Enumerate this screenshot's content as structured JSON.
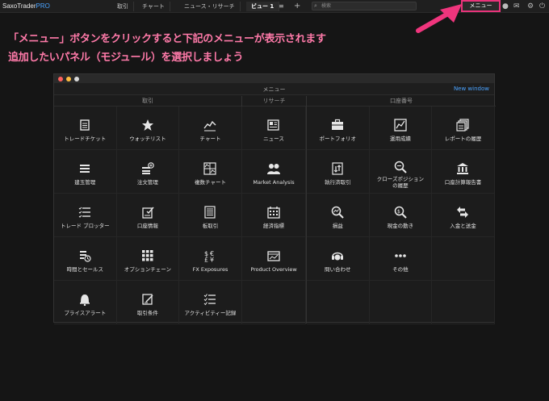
{
  "topbar": {
    "logo_main": "SaxoTrader",
    "logo_pro": "PRO",
    "tabs": [
      "取引",
      "チャート",
      "ニュース・リサーチ",
      "ビュー 1"
    ],
    "search_placeholder": "検索",
    "menu_button": "メニュー"
  },
  "annotation": {
    "line1": "「メニュー」ボタンをクリックすると下記のメニューが表示されます",
    "line2": "追加したいパネル（モジュール）を選択しましょう"
  },
  "window": {
    "title": "メニュー",
    "new_window": "New window"
  },
  "sections": [
    {
      "title": "取引",
      "items": [
        {
          "label": "トレードチケット",
          "icon": "trade-ticket-icon"
        },
        {
          "label": "ウォッチリスト",
          "icon": "star-icon"
        },
        {
          "label": "チャート",
          "icon": "chart-icon"
        },
        {
          "label": "建玉管理",
          "icon": "positions-icon"
        },
        {
          "label": "注文管理",
          "icon": "orders-icon"
        },
        {
          "label": "複数チャート",
          "icon": "multi-chart-icon"
        },
        {
          "label": "トレード ブロッター",
          "icon": "blotter-icon"
        },
        {
          "label": "口座情報",
          "icon": "account-info-icon"
        },
        {
          "label": "板取引",
          "icon": "depth-icon"
        },
        {
          "label": "時間とセールス",
          "icon": "time-sales-icon"
        },
        {
          "label": "オプションチェーン",
          "icon": "option-chain-icon"
        },
        {
          "label": "FX Exposures",
          "icon": "fx-exposure-icon"
        },
        {
          "label": "プライスアラート",
          "icon": "bell-icon"
        },
        {
          "label": "取引条件",
          "icon": "conditions-icon"
        },
        {
          "label": "アクティビティー記録",
          "icon": "activity-icon"
        }
      ]
    },
    {
      "title": "リサーチ",
      "items": [
        {
          "label": "ニュース",
          "icon": "news-icon"
        },
        {
          "label": "Market Analysis",
          "icon": "people-icon"
        },
        {
          "label": "経済指標",
          "icon": "calendar-icon"
        },
        {
          "label": "Product Overview",
          "icon": "product-icon"
        }
      ]
    },
    {
      "title": "口座番号",
      "items": [
        {
          "label": "ポートフォリオ",
          "icon": "portfolio-icon"
        },
        {
          "label": "運用成績",
          "icon": "performance-icon"
        },
        {
          "label": "レポートの履歴",
          "icon": "reports-icon"
        },
        {
          "label": "執行済取引",
          "icon": "executed-icon"
        },
        {
          "label": "クローズポジションの履歴",
          "icon": "closed-positions-icon"
        },
        {
          "label": "口座計算報告書",
          "icon": "bank-icon"
        },
        {
          "label": "損益",
          "icon": "pnl-icon"
        },
        {
          "label": "現金の動き",
          "icon": "cash-icon"
        },
        {
          "label": "入金と送金",
          "icon": "transfer-icon"
        },
        {
          "label": "問い合わせ",
          "icon": "support-icon"
        },
        {
          "label": "その他",
          "icon": "more-icon"
        }
      ]
    }
  ],
  "colors": {
    "accent": "#4aa3ff",
    "highlight": "#e8337a",
    "annotation": "#ff7aa9"
  }
}
